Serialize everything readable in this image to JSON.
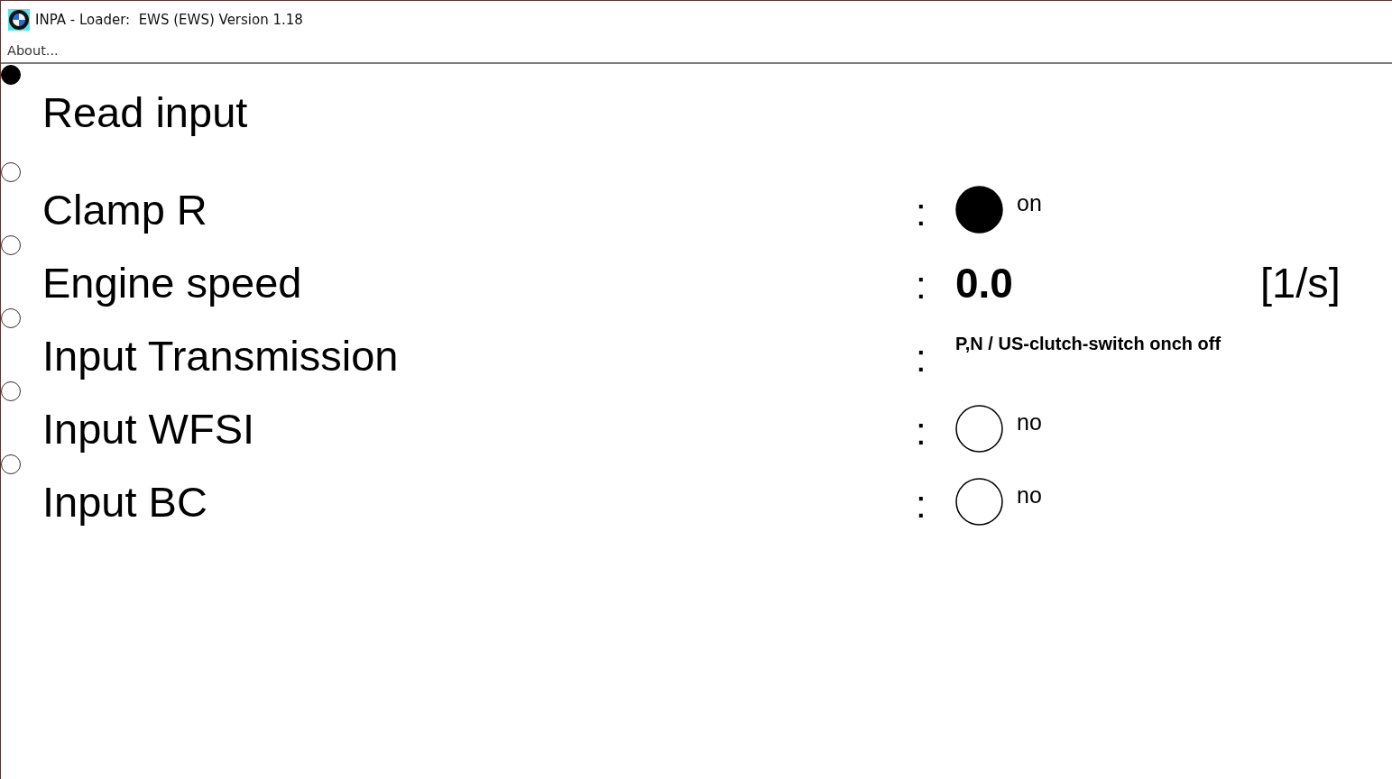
{
  "window": {
    "title": "INPA - Loader:  EWS (EWS) Version 1.18"
  },
  "menu": [
    {
      "label": "About..."
    }
  ],
  "rows": [
    {
      "kind": "heading",
      "label": "Read input",
      "selected": true
    },
    {
      "kind": "lamp",
      "label": "Clamp R",
      "separator": ":",
      "on": true,
      "state": "on",
      "selected": false
    },
    {
      "kind": "number",
      "label": "Engine speed",
      "separator": ":",
      "value": "0.0",
      "unit": "[1/s]",
      "selected": false
    },
    {
      "kind": "text",
      "label": "Input Transmission",
      "separator": ":",
      "value": "P,N / US-clutch-switch onch off",
      "selected": false
    },
    {
      "kind": "lamp",
      "label": "Input WFSI",
      "separator": ":",
      "on": false,
      "state": "no",
      "selected": false
    },
    {
      "kind": "lamp",
      "label": "Input BC",
      "separator": ":",
      "on": false,
      "state": "no",
      "selected": false
    }
  ]
}
